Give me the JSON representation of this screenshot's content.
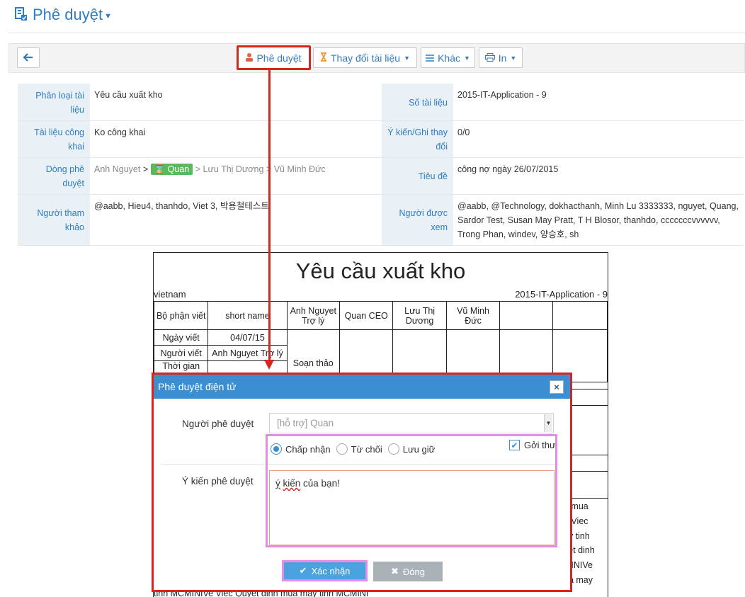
{
  "header": {
    "title": "Phê duyệt",
    "icon": "document-check-icon"
  },
  "toolbar": {
    "approve_label": "Phê duyệt",
    "change_doc_label": "Thay đổi tài liệu",
    "other_label": "Khác",
    "print_label": "In"
  },
  "info": {
    "category_label": "Phân loại tài liệu",
    "category_value": "Yêu cầu xuất kho",
    "doc_no_label": "Số tài liệu",
    "doc_no_value": "2015-IT-Application - 9",
    "private_label": "Tài liệu công khai",
    "private_value": "Ko công khai",
    "opinion_label": "Ý kiến/Ghi thay đổi",
    "opinion_value": "0/0",
    "flow_label": "Dòng phê duyệt",
    "flow": {
      "p1": "Anh Nguyet",
      "p2": "Quan",
      "p3": "Lưu Thị Dương",
      "p4": "Vũ Minh Đức",
      "sep": ">"
    },
    "subject_label": "Tiêu đề",
    "subject_value": "công nợ ngày 26/07/2015",
    "ref_label": "Người tham khảo",
    "ref_value": "@aabb, Hieu4, thanhdo, Viet 3, 박용철테스트",
    "viewers_label": "Người được xem",
    "viewers_value": "@aabb, @Technology, dokhacthanh, Minh Lu 3333333, nguyet, Quang, Sardor Test, Susan May Pratt, T H Blosor, thanhdo, cccccccvvvvvv, Trong Phan, windev, 양승호, sh"
  },
  "doc": {
    "title": "Yêu cầu xuất kho",
    "company": "vietnam",
    "doc_no": "2015-IT-Application - 9",
    "h_dept": "Bộ phận viết",
    "h_short": "short name",
    "h_a1": "Anh Nguyet Trợ lý",
    "h_a2": "Quan CEO",
    "h_a3": "Lưu Thị Dương",
    "h_a4": "Vũ Minh Đức",
    "date_label": "Ngày viết",
    "date_value": "04/07/15",
    "writer_label": "Người viết",
    "writer_value": "Anh Nguyet Trợ lý",
    "time_label": "Thời gian",
    "draft": "Soạn thảo",
    "text_lines": [
      "n mua",
      "e Viec",
      "ay tinh",
      "yet dinh",
      "MINIVe",
      "ua may"
    ],
    "bottom_line": "tinh MCMINIVe Viec Quyet dinh mua may tinh MCMINI"
  },
  "modal": {
    "title": "Phê duyệt điện tử",
    "close": "×",
    "approver_label": "Người phê duyệt",
    "approver_value": "[hỗ trợ] Quan",
    "opt_accept": "Chấp nhận",
    "opt_reject": "Từ chối",
    "opt_keep": "Lưu giữ",
    "send_mail": "Gởi thư",
    "comment_label": "Ý kiến phê duyệt",
    "comment_w1": "ý",
    "comment_w2": "kiến",
    "comment_rest": " của bạn!",
    "confirm": "Xác nhận",
    "cancel": "Đóng"
  }
}
